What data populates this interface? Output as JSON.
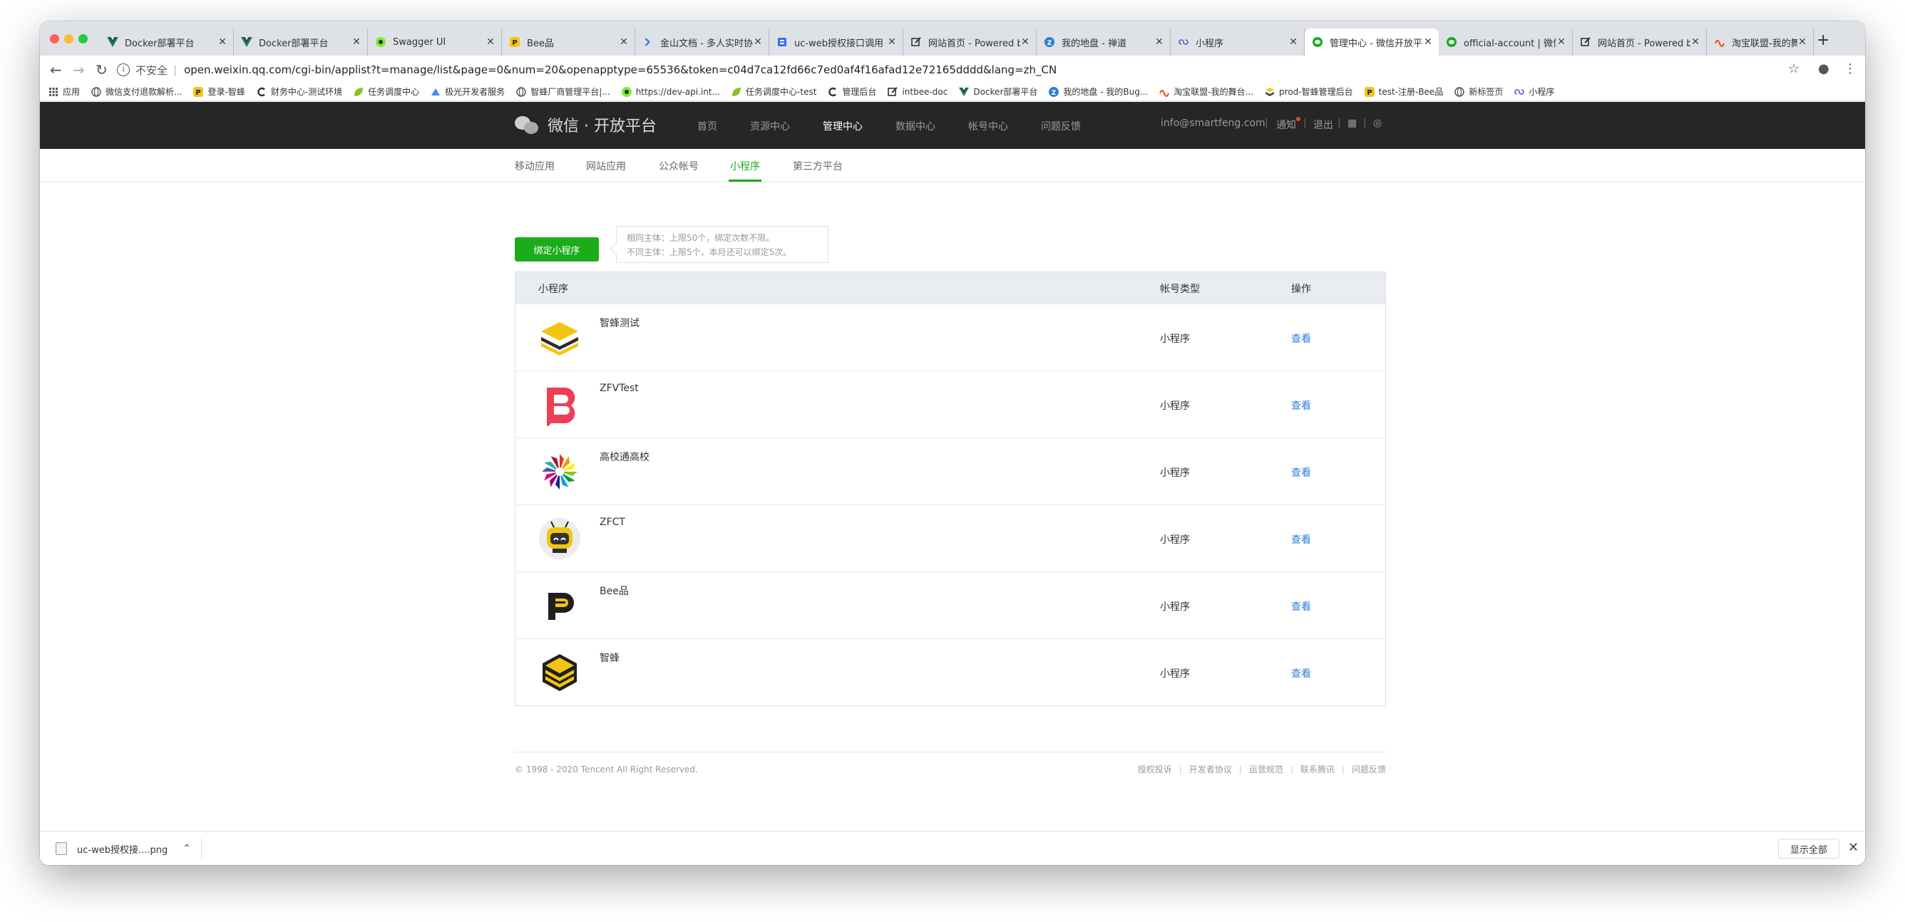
{
  "browser": {
    "tabs": [
      {
        "title": "Docker部署平台",
        "icon": "vue-v-icon",
        "color": "#1a7f5a",
        "active": false
      },
      {
        "title": "Docker部署平台",
        "icon": "vue-v-icon",
        "color": "#1a7f5a",
        "active": false
      },
      {
        "title": "Swagger UI",
        "icon": "swagger-icon",
        "color": "#85ea2d",
        "active": false
      },
      {
        "title": "Bee品",
        "icon": "bee-p-icon",
        "color": "#f5c518",
        "active": false
      },
      {
        "title": "金山文档 - 多人实时协",
        "icon": "kdocs-icon",
        "color": "#3a6df0",
        "active": false
      },
      {
        "title": "uc-web授权接口调用",
        "icon": "doc-icon",
        "color": "#3a6df0",
        "active": false
      },
      {
        "title": "网站首页 - Powered by",
        "icon": "edit-icon",
        "color": "#333333",
        "active": false
      },
      {
        "title": "我的地盘 - 禅道",
        "icon": "zentao-icon",
        "color": "#2a7fd4",
        "active": false
      },
      {
        "title": "小程序",
        "icon": "miniprogram-icon",
        "color": "#5b6ddc",
        "active": false
      },
      {
        "title": "管理中心 - 微信开放平台",
        "icon": "wechat-icon",
        "color": "#1aad19",
        "active": true
      },
      {
        "title": "official-account | 微信",
        "icon": "wechat-icon",
        "color": "#1aad19",
        "active": false
      },
      {
        "title": "网站首页 - Powered by",
        "icon": "edit-icon",
        "color": "#333333",
        "active": false
      },
      {
        "title": "淘宝联盟-我的舞台",
        "icon": "taobao-icon",
        "color": "#ff4400",
        "active": false
      }
    ],
    "address": {
      "insecure_label": "不安全",
      "url": "open.weixin.qq.com/cgi-bin/applist?t=manage/list&page=0&num=20&openapptype=65536&token=c04d7ca12fd66c7ed0af4f16afad12e72165dddd&lang=zh_CN"
    },
    "bookmarks": [
      {
        "label": "应用",
        "icon": "apps-grid-icon",
        "color": "#555555"
      },
      {
        "label": "微信支付退款解析...",
        "icon": "globe-icon",
        "color": "#555555"
      },
      {
        "label": "登录-智蜂",
        "icon": "bee-p-icon",
        "color": "#f5c518"
      },
      {
        "label": "财务中心-测试环境",
        "icon": "c-logo-icon",
        "color": "#333333"
      },
      {
        "label": "任务调度中心",
        "icon": "leaf-icon",
        "color": "#8bbf2a"
      },
      {
        "label": "极光开发者服务",
        "icon": "aurora-icon",
        "color": "#3a8ee6"
      },
      {
        "label": "智蜂厂商管理平台|...",
        "icon": "globe-icon",
        "color": "#555555"
      },
      {
        "label": "https://dev-api.int...",
        "icon": "swagger-icon",
        "color": "#85ea2d"
      },
      {
        "label": "任务调度中心-test",
        "icon": "leaf-icon",
        "color": "#8bbf2a"
      },
      {
        "label": "管理后台",
        "icon": "c-logo-icon",
        "color": "#333333"
      },
      {
        "label": "intbee-doc",
        "icon": "edit-icon",
        "color": "#333333"
      },
      {
        "label": "Docker部署平台",
        "icon": "vue-v-icon",
        "color": "#1a7f5a"
      },
      {
        "label": "我的地盘 - 我的Bug...",
        "icon": "zentao-icon",
        "color": "#2a7fd4"
      },
      {
        "label": "淘宝联盟-我的舞台...",
        "icon": "taobao-icon",
        "color": "#ff4400"
      },
      {
        "label": "prod-智蜂管理后台",
        "icon": "bee-stack-icon",
        "color": "#f5c518"
      },
      {
        "label": "test-注册-Bee品",
        "icon": "bee-p-icon",
        "color": "#f5c518"
      },
      {
        "label": "新标签页",
        "icon": "globe-icon",
        "color": "#555555"
      },
      {
        "label": "小程序",
        "icon": "miniprogram-icon",
        "color": "#5b6ddc"
      }
    ]
  },
  "header": {
    "brand": "微信 · 开放平台",
    "nav": [
      {
        "label": "首页",
        "active": false
      },
      {
        "label": "资源中心",
        "active": false
      },
      {
        "label": "管理中心",
        "active": true
      },
      {
        "label": "数据中心",
        "active": false
      },
      {
        "label": "帐号中心",
        "active": false
      },
      {
        "label": "问题反馈",
        "active": false
      }
    ],
    "email": "info@smartfeng.com",
    "notify": "通知",
    "logout": "退出"
  },
  "subnav": {
    "items": [
      {
        "label": "移动应用",
        "active": false
      },
      {
        "label": "网站应用",
        "active": false
      },
      {
        "label": "公众帐号",
        "active": false
      },
      {
        "label": "小程序",
        "active": true
      },
      {
        "label": "第三方平台",
        "active": false
      }
    ]
  },
  "main": {
    "bind_button": "绑定小程序",
    "tip_lines": [
      "相同主体：上限50个，绑定次数不限。",
      "不同主体：上限5个，本月还可以绑定5次。"
    ],
    "table": {
      "headers": {
        "name": "小程序",
        "type": "帐号类型",
        "action": "操作"
      },
      "rows": [
        {
          "name": "智蜂测试",
          "type": "小程序",
          "action": "查看",
          "icon": "bee-stack-icon"
        },
        {
          "name": "ZFVTest",
          "type": "小程序",
          "action": "查看",
          "icon": "red-b-icon"
        },
        {
          "name": "高校通高校",
          "type": "小程序",
          "action": "查看",
          "icon": "colorful-flower-icon"
        },
        {
          "name": "ZFCT",
          "type": "小程序",
          "action": "查看",
          "icon": "robot-bee-icon"
        },
        {
          "name": "Bee品",
          "type": "小程序",
          "action": "查看",
          "icon": "bee-p-icon"
        },
        {
          "name": "智蜂",
          "type": "小程序",
          "action": "查看",
          "icon": "bee-hex-icon"
        }
      ]
    }
  },
  "footer": {
    "copyright": "© 1998 - 2020 Tencent All Right Reserved.",
    "links": [
      "授权投诉",
      "开发者协议",
      "运营规范",
      "联系腾讯",
      "问题反馈"
    ]
  },
  "downloads": {
    "file": "uc-web授权接....png",
    "show_all": "显示全部"
  },
  "colors": {
    "accent": "#1aad19",
    "link": "#2e7cdb",
    "header_bg": "#262626"
  }
}
